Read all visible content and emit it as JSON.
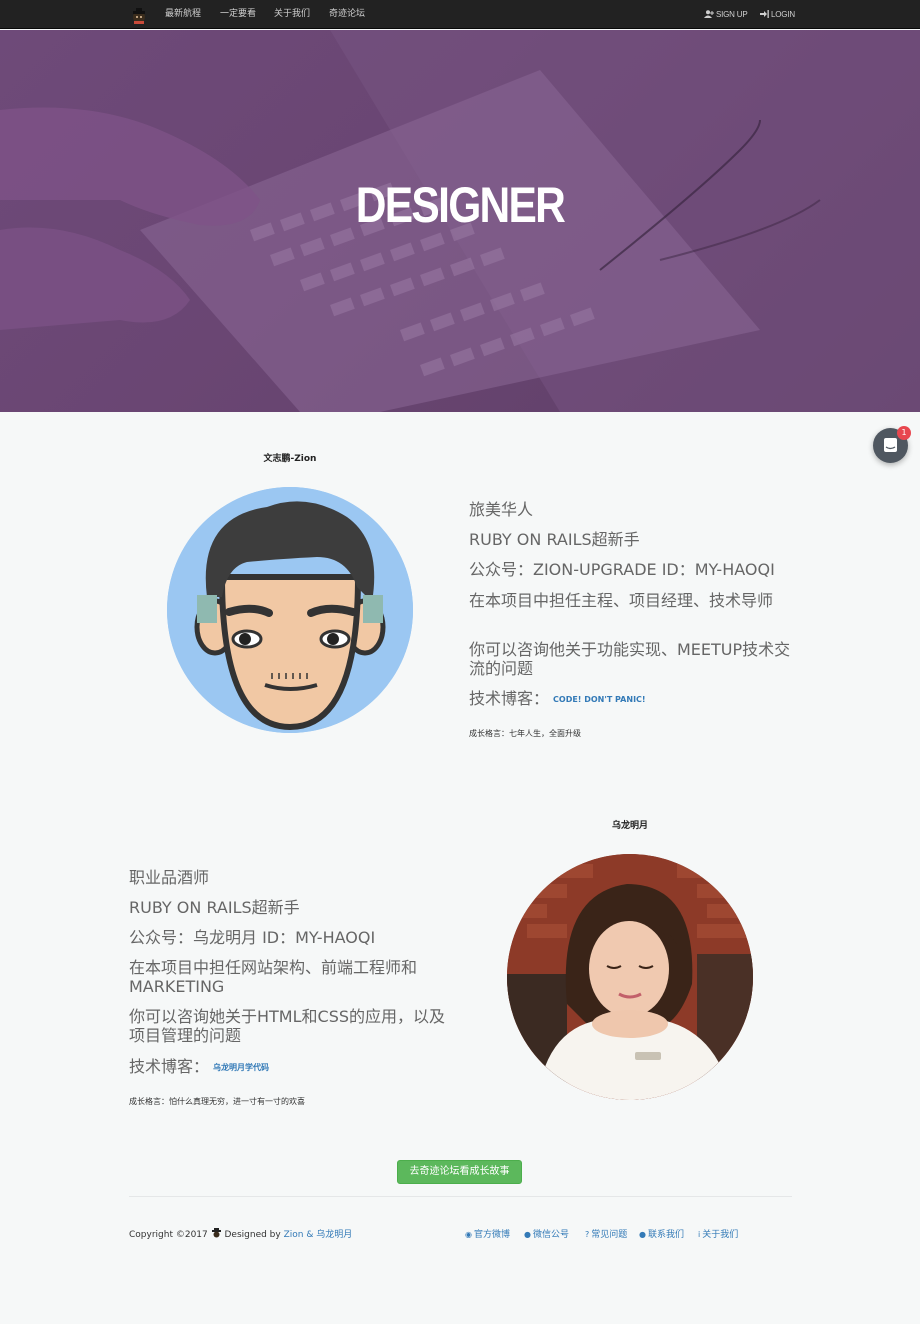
{
  "nav": {
    "links": [
      "最新航程",
      "一定要看",
      "关于我们",
      "奇迹论坛"
    ],
    "signup": "SIGN UP",
    "login": "LOGIN"
  },
  "hero": {
    "title": "DESIGNER"
  },
  "chat": {
    "badge": "1"
  },
  "profiles": [
    {
      "name": "文志鹏-Zion",
      "lines": [
        "旅美华人",
        "RUBY ON RAILS超新手",
        "公众号：ZION-UPGRADE ID：MY-HAOQI",
        "在本项目中担任主程、项目经理、技术导师",
        "你可以咨询他关于功能实现、MEETUP技术交流的问题"
      ],
      "blog_label": "技术博客：",
      "blog_link": "CODE! DON'T PANIC!",
      "motto": "成长格言：七年人生，全面升级"
    },
    {
      "name": "乌龙明月",
      "lines": [
        "职业品酒师",
        "RUBY ON RAILS超新手",
        "公众号：乌龙明月 ID：MY-HAOQI",
        "在本项目中担任网站架构、前端工程师和MARKETING",
        "你可以咨询她关于HTML和CSS的应用，以及项目管理的问题"
      ],
      "blog_label": "技术博客：",
      "blog_link": "乌龙明月学代码",
      "motto": "成长格言：怕什么真理无穷，进一寸有一寸的欢喜"
    }
  ],
  "cta": {
    "label": "去奇迹论坛看成长故事"
  },
  "footer": {
    "copyright_prefix": "Copyright ©2017",
    "designed_by": "Designed by",
    "designers": "Zion & 乌龙明月",
    "links": [
      "官方微博",
      "微信公号",
      "常见问题",
      "联系我们",
      "关于我们"
    ]
  },
  "colors": {
    "nav_bg": "#222222",
    "hero_overlay": "#6a4673",
    "link": "#337ab7",
    "cta": "#5cb85c",
    "badge": "#e8474f"
  }
}
